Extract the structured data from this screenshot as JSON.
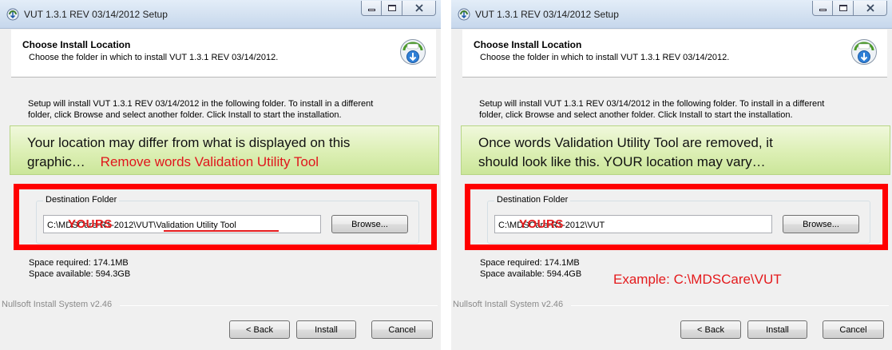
{
  "windows": [
    {
      "title": "VUT 1.3.1 REV 03/14/2012 Setup",
      "header_title": "Choose Install Location",
      "header_subtitle": "Choose the folder in which to install VUT 1.3.1 REV 03/14/2012.",
      "body_line1": "Setup will install VUT 1.3.1 REV 03/14/2012 in the following folder. To install in a different",
      "body_line2": "folder, click Browse and select another folder. Click Install to start the installation.",
      "callout_line1": "Your location may differ from what is displayed on this",
      "callout_line2": "graphic…",
      "callout_red": "Remove words Validation Utility Tool",
      "dest_legend": "Destination Folder",
      "path_text": "C:\\MDSCare-R1-2012\\VUT\\Validation Utility Tool",
      "yours_overlay": "YOURS",
      "browse_label": "Browse...",
      "space_required": "Space required: 174.1MB",
      "space_available": "Space available: 594.3GB",
      "nsis_label": "Nullsoft Install System v2.46",
      "back_label": "< Back",
      "install_label": "Install",
      "cancel_label": "Cancel"
    },
    {
      "title": "VUT 1.3.1 REV 03/14/2012 Setup",
      "header_title": "Choose Install Location",
      "header_subtitle": "Choose the folder in which to install VUT 1.3.1 REV 03/14/2012.",
      "body_line1": "Setup will install VUT 1.3.1 REV 03/14/2012 in the following folder. To install in a different",
      "body_line2": "folder, click Browse and select another folder. Click Install to start the installation.",
      "callout_line1": "Once words Validation Utility Tool are removed, it",
      "callout_line2": "should look like this.  YOUR location may vary…",
      "dest_legend": "Destination Folder",
      "path_text": "C:\\MDSCare-R1-2012\\VUT",
      "yours_overlay": "YOURS",
      "browse_label": "Browse...",
      "space_required": "Space required: 174.1MB",
      "space_available": "Space available: 594.4GB",
      "example_text": "Example:  C:\\MDSCare\\VUT",
      "nsis_label": "Nullsoft Install System v2.46",
      "back_label": "< Back",
      "install_label": "Install",
      "cancel_label": "Cancel"
    }
  ],
  "icons": [
    "setup-app-icon",
    "minimize-icon",
    "maximize-icon",
    "close-icon",
    "installer-download-icon"
  ],
  "colors": {
    "annotation_red": "#ff0000",
    "callout_green": "#dcefb4",
    "titlebar_blue": "#d3e1f1"
  }
}
